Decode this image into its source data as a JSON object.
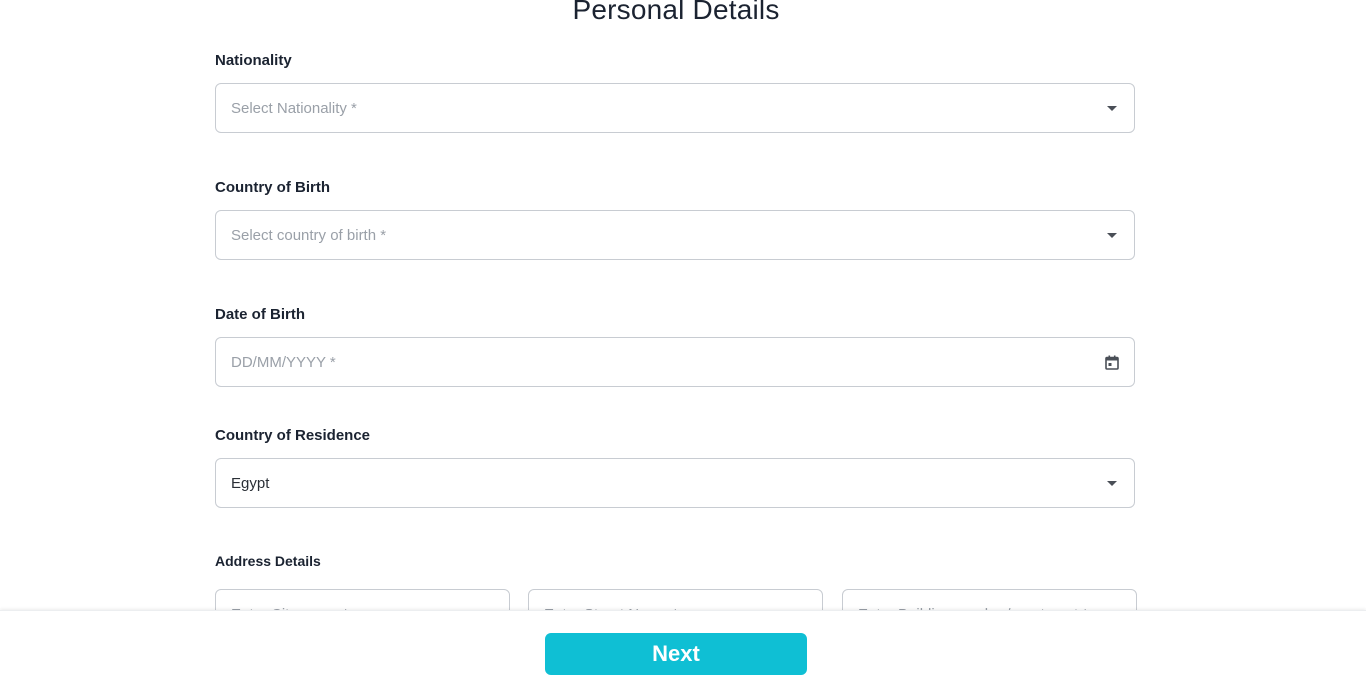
{
  "page": {
    "title": "Personal Details"
  },
  "nationality": {
    "label": "Nationality",
    "placeholder": "Select Nationality *",
    "icon": "chevron-down-icon"
  },
  "country_of_birth": {
    "label": "Country of Birth",
    "placeholder": "Select country of birth *",
    "icon": "chevron-down-icon"
  },
  "date_of_birth": {
    "label": "Date of Birth",
    "placeholder": "DD/MM/YYYY *",
    "icon": "calendar-icon"
  },
  "country_of_residence": {
    "label": "Country of Residence",
    "value": "Egypt",
    "icon": "chevron-down-icon"
  },
  "address_details": {
    "label": "Address Details",
    "fields": [
      {
        "placeholder": "Enter City name *"
      },
      {
        "placeholder": "Enter Street Name *"
      },
      {
        "placeholder": "Enter Building number/apartment *"
      }
    ]
  },
  "footer": {
    "next_label": "Next",
    "accent_color": "#0fbfd4"
  }
}
